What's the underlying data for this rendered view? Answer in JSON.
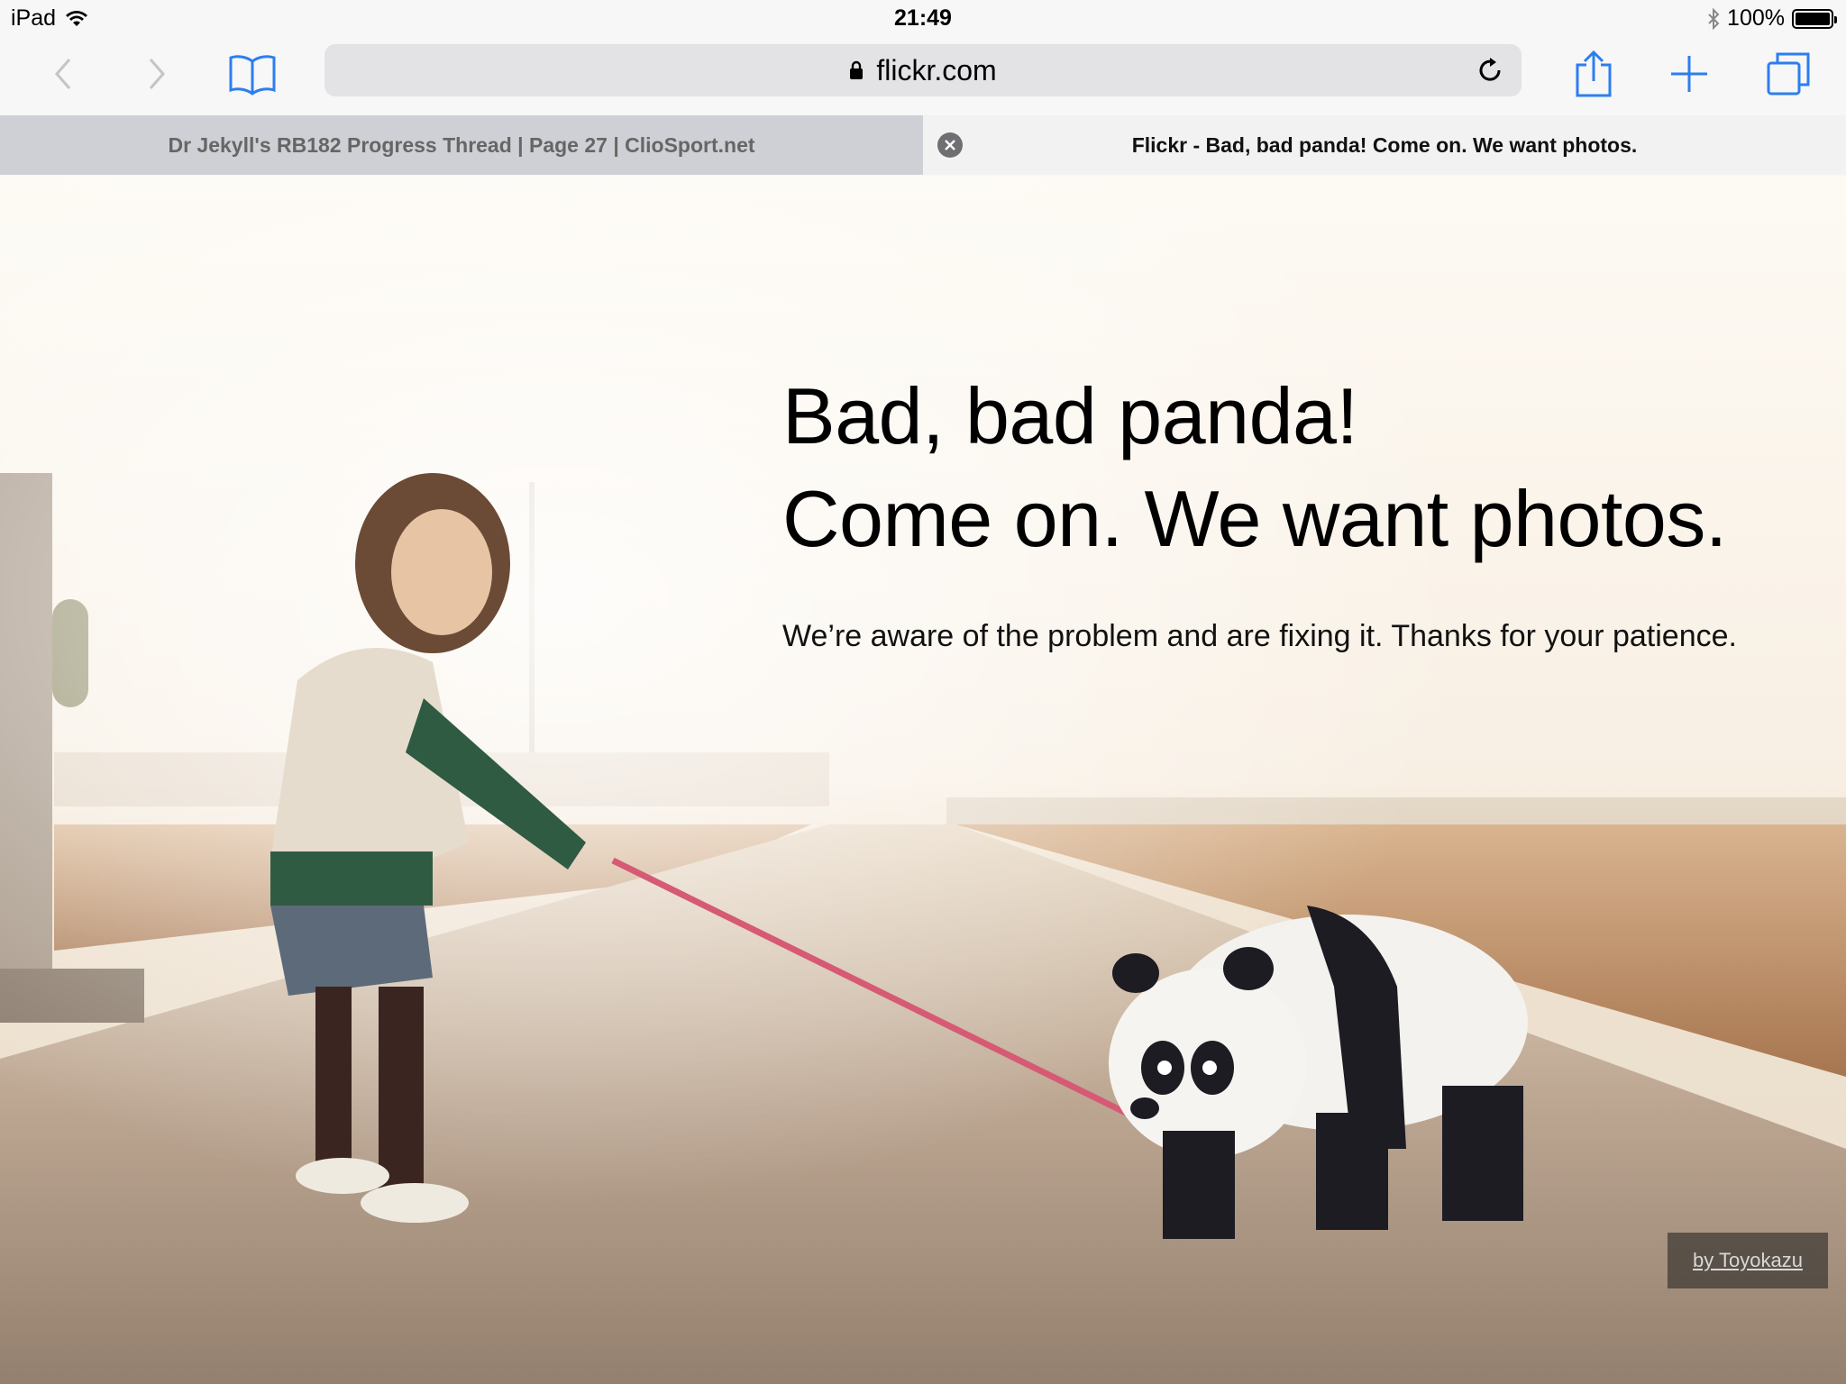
{
  "status_bar": {
    "device": "iPad",
    "time": "21:49",
    "battery": "100%",
    "battery_level": 1.0
  },
  "toolbar": {
    "url": "flickr.com",
    "icons": [
      "back-icon",
      "forward-icon",
      "bookmarks-icon",
      "lock-icon",
      "reload-icon",
      "share-icon",
      "new-tab-icon",
      "tabs-icon"
    ],
    "accent_color": "#2c7ef0"
  },
  "tabs": [
    {
      "title": "Dr Jekyll's RB182 Progress Thread | Page 27 | ClioSport.net",
      "active": false
    },
    {
      "title": "Flickr - Bad, bad panda! Come on. We want photos.",
      "active": true
    }
  ],
  "page": {
    "headline_line1": "Bad, bad panda!",
    "headline_line2": "Come on. We want photos.",
    "message": "We’re aware of the problem and are fixing it. Thanks for your patience.",
    "credit": "by Toyokazu"
  }
}
